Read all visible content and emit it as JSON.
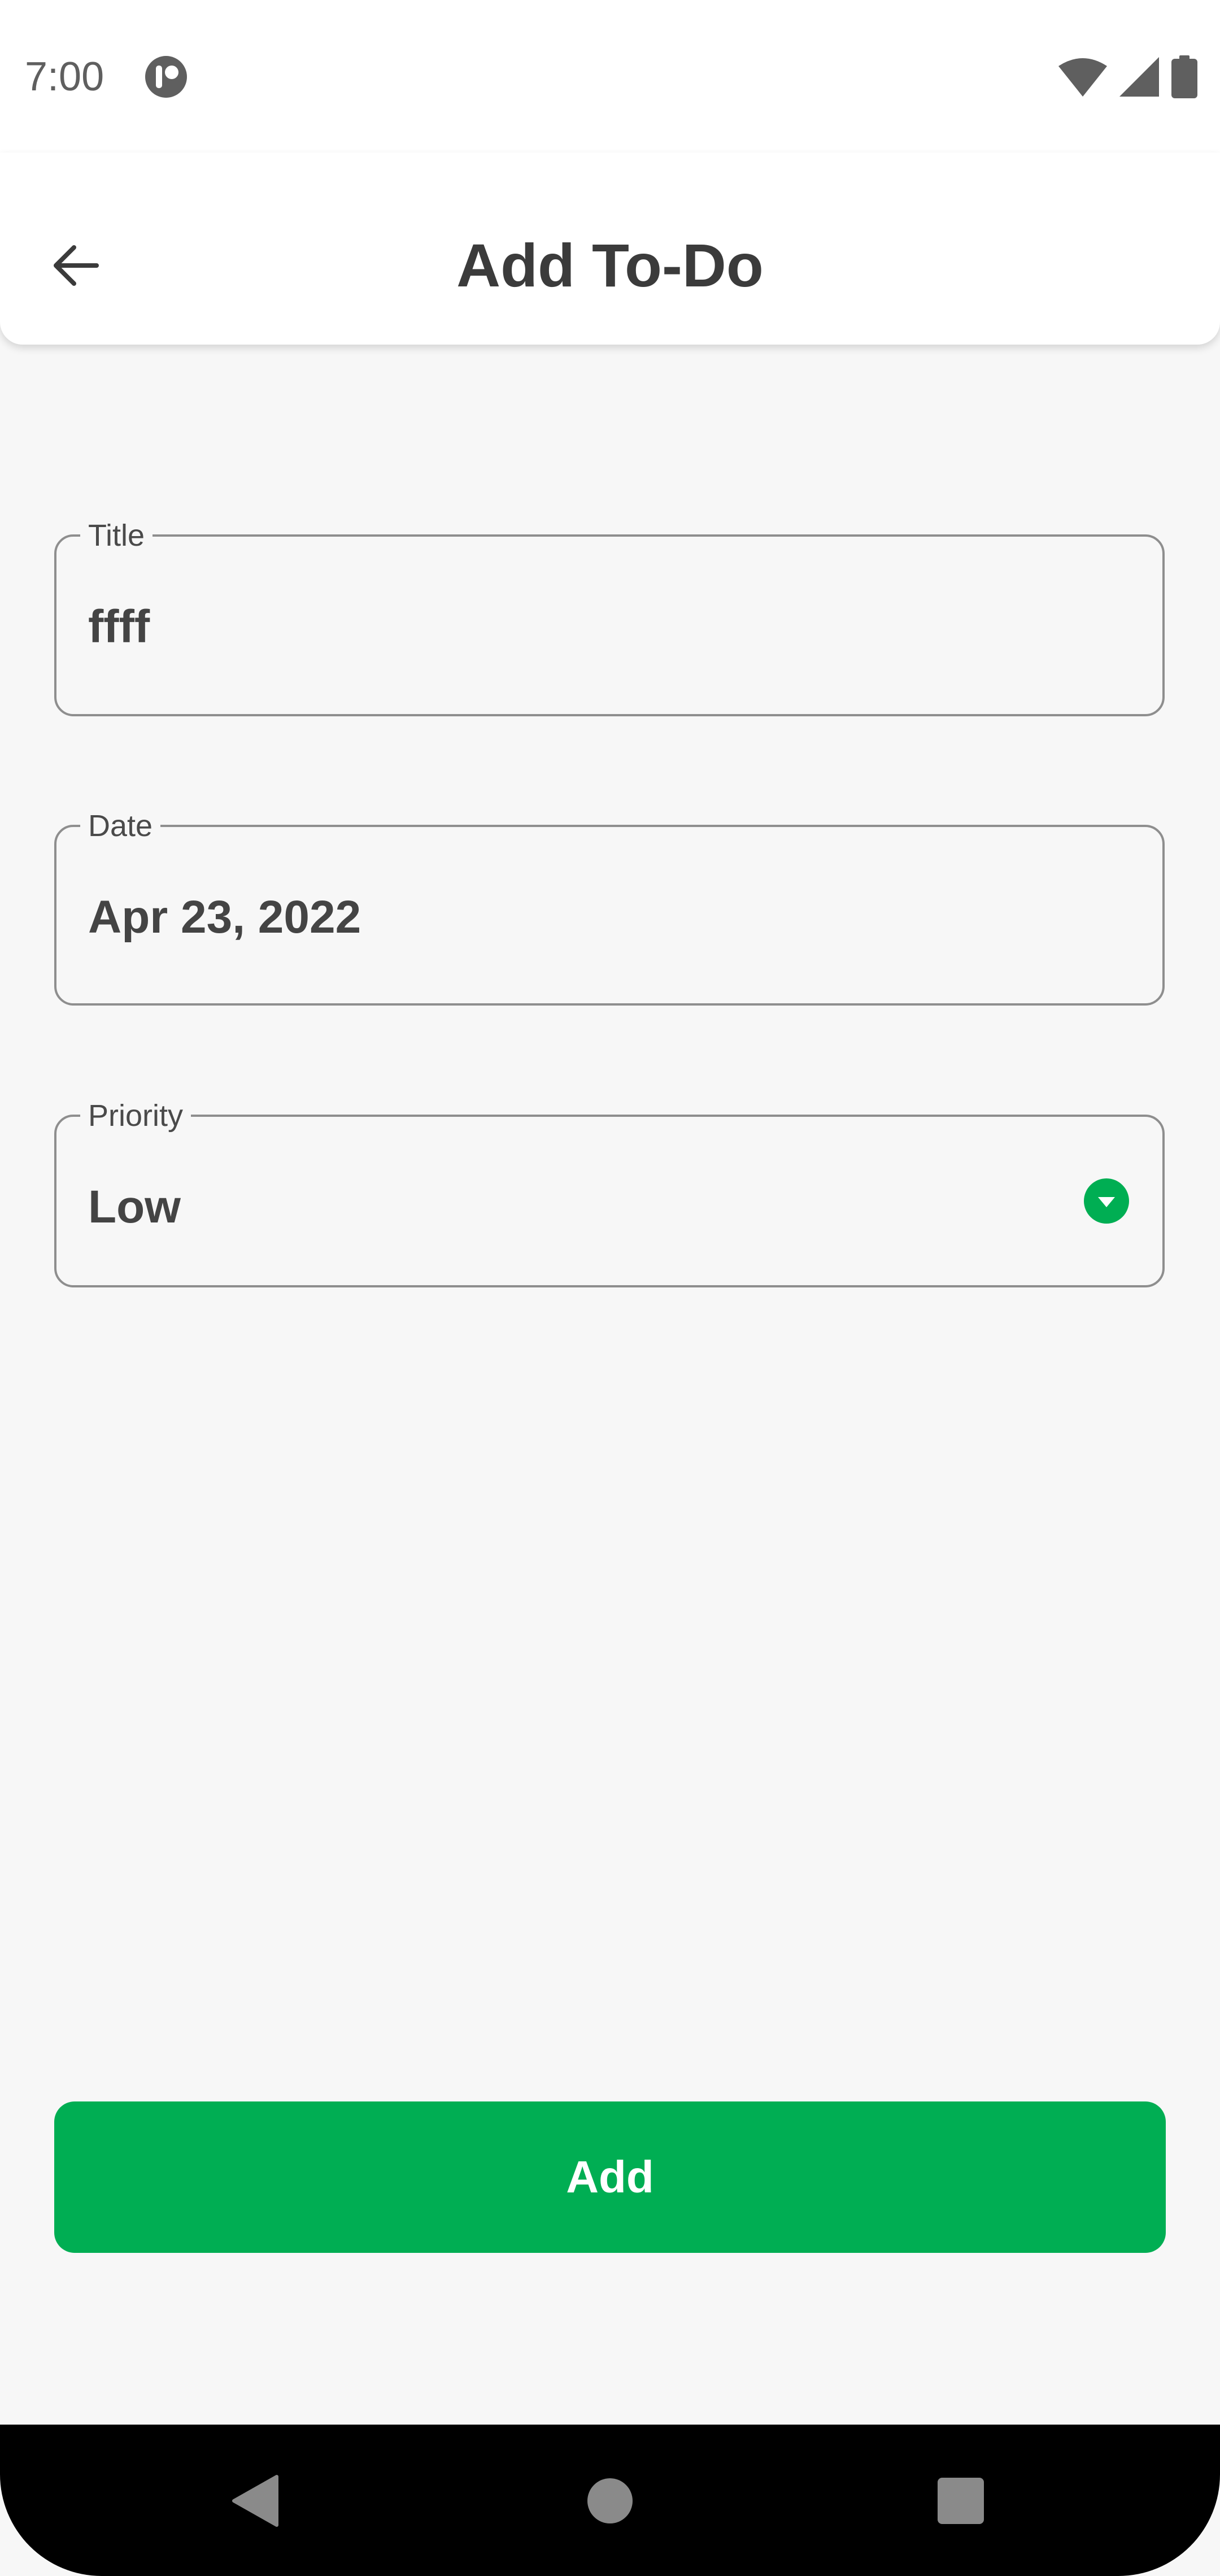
{
  "status_bar": {
    "time": "7:00",
    "icons": [
      "app-notification-icon",
      "wifi-icon",
      "cell-signal-icon",
      "battery-icon"
    ]
  },
  "header": {
    "title": "Add To-Do",
    "back_icon": "arrow-back-icon"
  },
  "form": {
    "title": {
      "label": "Title",
      "value": "ffff"
    },
    "date": {
      "label": "Date",
      "value": "Apr 23, 2022"
    },
    "priority": {
      "label": "Priority",
      "value": "Low",
      "icon": "dropdown-icon"
    }
  },
  "actions": {
    "add_label": "Add"
  },
  "nav_bar": {
    "icons": [
      "nav-back-icon",
      "nav-home-icon",
      "nav-recents-icon"
    ]
  },
  "colors": {
    "accent": "#00AE53",
    "background": "#F7F7F7",
    "text": "#3D3D3D",
    "field_border": "#8E8E8E"
  }
}
